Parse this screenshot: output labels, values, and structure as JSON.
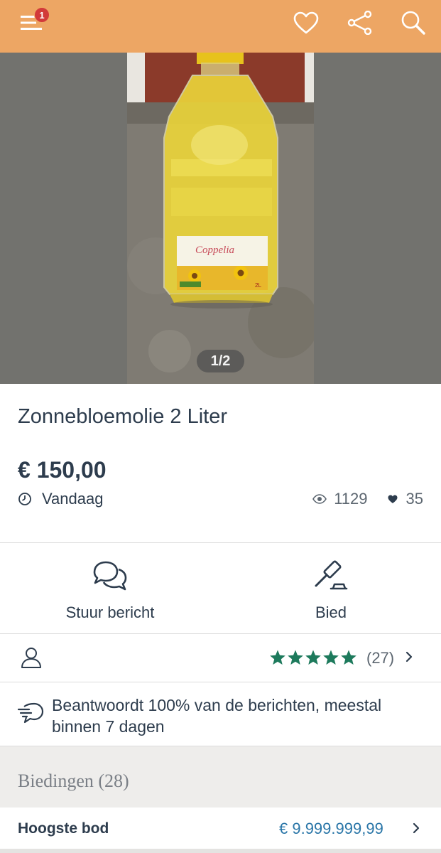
{
  "header": {
    "menu_badge": "1",
    "icons": [
      "menu-icon",
      "heart-icon",
      "share-icon",
      "search-icon"
    ]
  },
  "gallery": {
    "counter": "1/2"
  },
  "listing": {
    "title": "Zonnebloemolie 2 Liter",
    "price": "€ 150,00",
    "date": "Vandaag",
    "views": "1129",
    "favorites": "35"
  },
  "actions": {
    "message_label": "Stuur bericht",
    "bid_label": "Bied"
  },
  "seller": {
    "rating_stars": 5,
    "reviews": "(27)"
  },
  "response": {
    "text": "Beantwoordt 100% van de berichten, meestal binnen 7 dagen"
  },
  "bids": {
    "header": "Biedingen (28)",
    "highest_label": "Hoogste bod",
    "highest_value": "€ 9.999.999,99"
  },
  "colors": {
    "header_bg": "#eda664",
    "badge": "#d23a3a",
    "stars": "#1d7a5c",
    "link": "#2a76a8",
    "text": "#2d3c4d"
  }
}
